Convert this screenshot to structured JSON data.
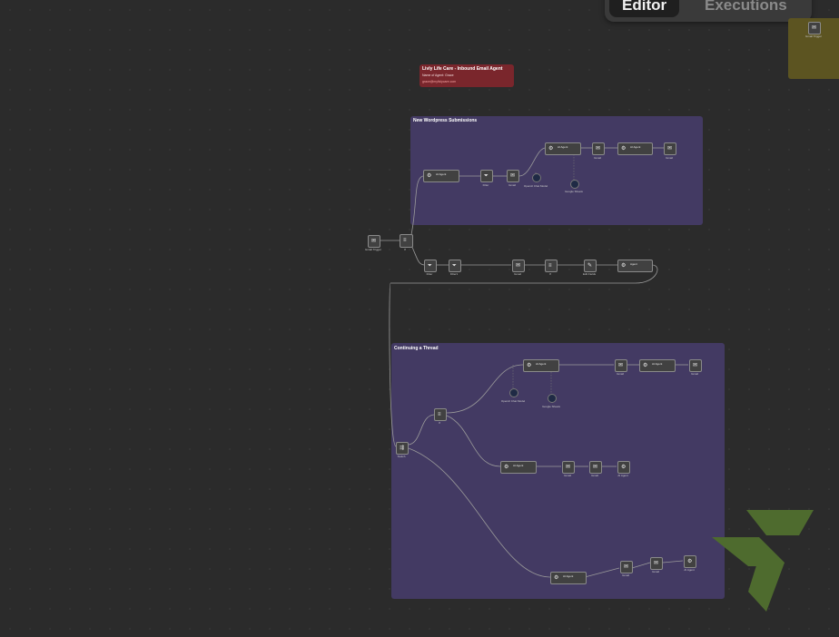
{
  "tabs": {
    "editor": "Editor",
    "executions": "Executions"
  },
  "notes": {
    "main_title": "Livly Life Care - Inbound Email Agent",
    "main_sub": "Name of Agent: Grace",
    "main_email": "grace@mylivlycare.com",
    "wordpress_group": "New Wordpress Submissions",
    "thread_group": "Continuing a Thread"
  },
  "nodes": {
    "trigger": "Gmail Trigger",
    "if_main": "If",
    "filter1": "Filter",
    "filter2": "Filter1",
    "gmail_get": "Gmail",
    "if_lower": "If",
    "edit_fields": "Edit Fields",
    "agent_lower": "Agent",
    "agent_top": "AI Agent",
    "filter_top": "Filter",
    "gmail_top": "Gmail",
    "openai_model": "OpenAI Chat Model",
    "agent_top2": "AI Agent",
    "sheets": "Google Sheets",
    "gmail_send": "Gmail",
    "agent_send": "AI Agent",
    "gmail_out": "Gmail",
    "switch": "Switch",
    "if_thread": "If",
    "agent_thread": "AI Agent",
    "agent_thread_model": "OpenAI Chat Model",
    "agent_thread_sheets": "Google Sheets",
    "gmail_thread": "Gmail",
    "agent_thread2": "AI Agent",
    "gmail_thread2": "Gmail",
    "agent_mid": "AI Agent",
    "gmail_mid": "Gmail",
    "gmail_mid2": "Gmail",
    "agent_mid2": "AI Agent",
    "agent_low": "AI Agent",
    "gmail_low": "Gmail",
    "gmail_low2": "Gmail",
    "agent_low2": "AI Agent",
    "olive_node": "Gmail Trigger"
  },
  "icons": {
    "gmail": "gmail-icon",
    "if": "if-branch-icon",
    "filter": "filter-icon",
    "agent": "robot-icon",
    "edit": "pencil-icon"
  },
  "colors": {
    "canvas": "#2b2b2b",
    "purple_group": "#433a63",
    "red_note": "#7a262c",
    "olive_note": "#5c5421",
    "logo_green": "#4e6b2e"
  }
}
